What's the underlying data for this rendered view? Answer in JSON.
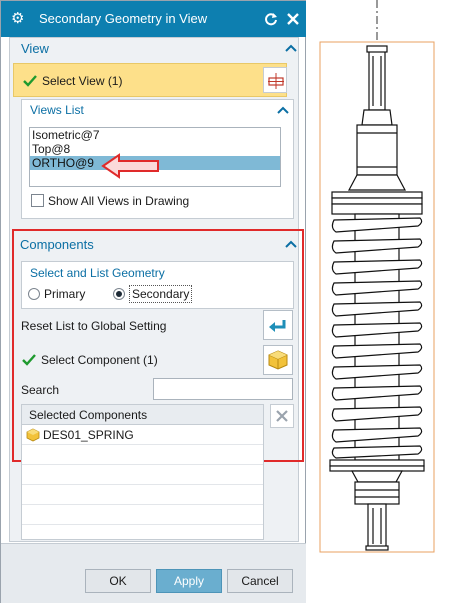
{
  "dialog": {
    "title": "Secondary Geometry in View",
    "title_bg": "#0d7fb0"
  },
  "view_section": {
    "header": "View",
    "select_view_label": "Select View (1)",
    "views_list_header": "Views List",
    "views": [
      "Isometric@7",
      "Top@8",
      "ORTHO@9"
    ],
    "selected_view": "ORTHO@9",
    "show_all_label": "Show All Views in Drawing",
    "show_all_checked": false
  },
  "components_section": {
    "header": "Components",
    "select_geometry_header": "Select and List Geometry",
    "radio_primary": "Primary",
    "radio_secondary": "Secondary",
    "radio_selected": "Secondary",
    "reset_label": "Reset List to Global Setting",
    "select_component_label": "Select Component (1)",
    "search_label": "Search",
    "search_value": "",
    "table_header": "Selected Components",
    "rows": [
      "DES01_SPRING"
    ]
  },
  "buttons": {
    "ok": "OK",
    "apply": "Apply",
    "cancel": "Cancel"
  },
  "colors": {
    "accent": "#0d7fb0",
    "highlight": "#fde08a",
    "annotation_red": "#e02a2a",
    "drawing_frame": "#e8a060"
  }
}
